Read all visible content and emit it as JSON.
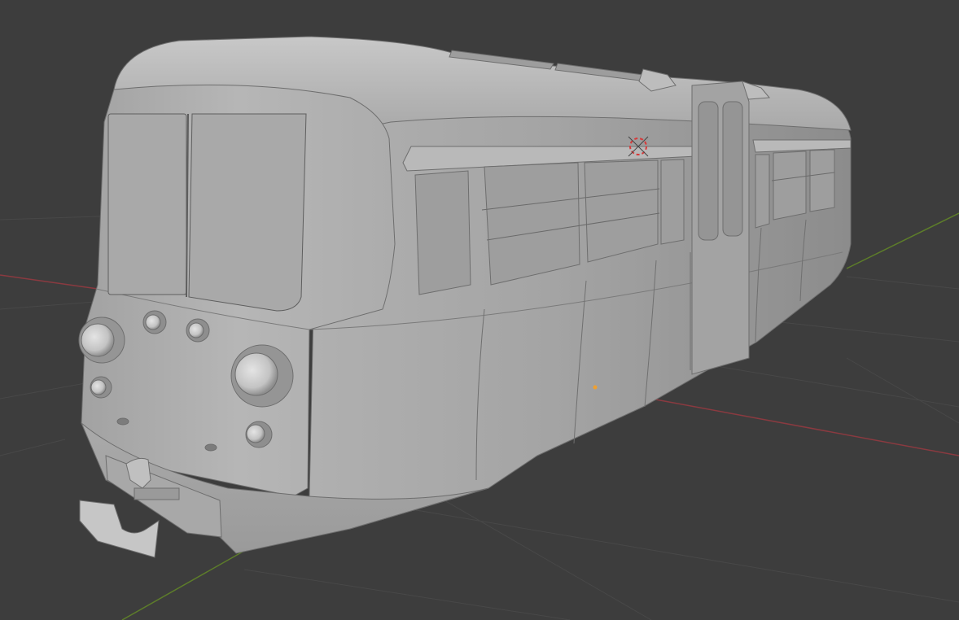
{
  "viewport": {
    "editor": "3D Viewport",
    "view_mode": "solid-shading",
    "background_color": "#3d3d3d",
    "grid_color": "#4a4a4a",
    "x_axis_color": "#8a3a40",
    "y_axis_color": "#5d7d2a",
    "mesh_base_color": "#b3b3b3"
  },
  "scene": {
    "object_type": "railcar-body-model",
    "gizmos": [
      "3d-cursor-icon",
      "object-origin-icon"
    ]
  }
}
